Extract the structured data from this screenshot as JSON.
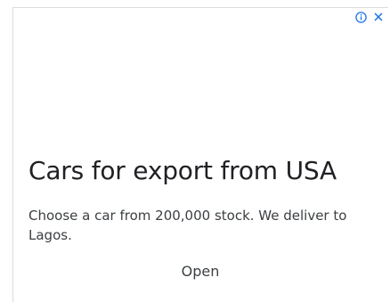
{
  "ad": {
    "headline": "Cars for export from USA",
    "description": "Choose a car from 200,000 stock. We deliver to Lagos.",
    "cta_label": "Open"
  },
  "badge": {
    "info_icon": "info-circle-icon",
    "close_icon": "close-icon",
    "accent_color": "#1a73e8"
  }
}
